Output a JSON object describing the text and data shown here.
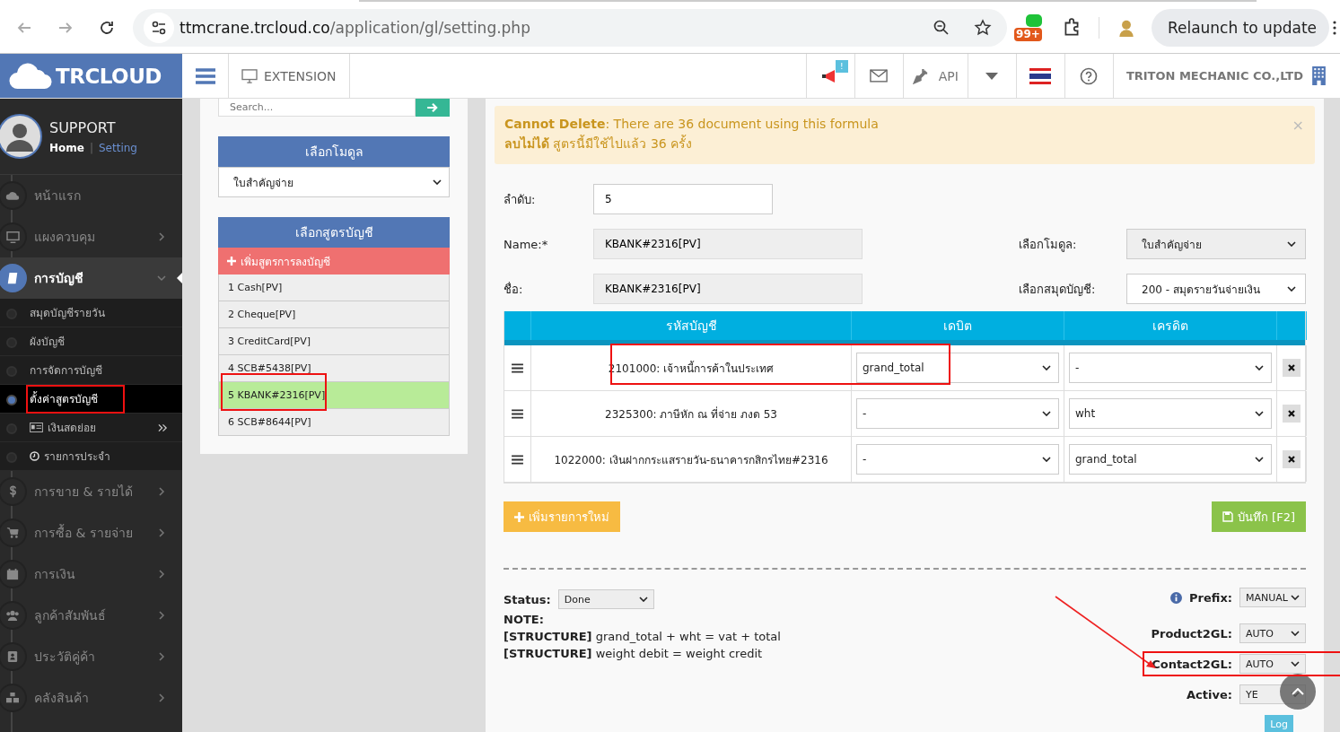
{
  "browser": {
    "url_host": "ttmcrane.trcloud.co",
    "url_path": "/application/gl/setting.php",
    "badge": "99+",
    "relaunch": "Relaunch to update"
  },
  "header": {
    "logo": "TRCLOUD",
    "extension": "EXTENSION",
    "notify_badge": "!",
    "api": "API",
    "company": "TRITON MECHANIC CO.,LTD"
  },
  "sidebar": {
    "user": "SUPPORT",
    "home": "Home",
    "separator": "|",
    "setting": "Setting",
    "items": [
      {
        "label": "หน้าแรก",
        "selected": false,
        "expanded": false
      },
      {
        "label": "แผงควบคุม",
        "selected": false,
        "expanded": false
      },
      {
        "label": "การบัญชี",
        "selected": true,
        "expanded": true,
        "children": [
          {
            "label": "สมุดบัญชีรายวัน",
            "selected": false,
            "annotated": false
          },
          {
            "label": "ผังบัญชี",
            "selected": false,
            "annotated": false
          },
          {
            "label": "การจัดการบัญชี",
            "selected": false,
            "annotated": false
          },
          {
            "label": "ตั้งค่าสูตรบัญชี",
            "selected": true,
            "annotated": true
          },
          {
            "label": "เงินสดย่อย",
            "selected": false,
            "annotated": false
          },
          {
            "label": "รายการประจำ",
            "selected": false,
            "annotated": false
          }
        ]
      },
      {
        "label": "การขาย & รายได้",
        "selected": false,
        "expanded": false
      },
      {
        "label": "การซื้อ & รายจ่าย",
        "selected": false,
        "expanded": false
      },
      {
        "label": "การเงิน",
        "selected": false,
        "expanded": false
      },
      {
        "label": "ลูกค้าสัมพันธ์",
        "selected": false,
        "expanded": false
      },
      {
        "label": "ประวัติคู่ค้า",
        "selected": false,
        "expanded": false
      },
      {
        "label": "คลังสินค้า",
        "selected": false,
        "expanded": false
      }
    ]
  },
  "panel": {
    "search_placeholder": "Search...",
    "module_title": "เลือกโมดูล",
    "module_value": "ใบสำคัญจ่าย",
    "formula_title": "เลือกสูตรบัญชี",
    "add_label": "เพิ่มสูตรการลงบัญชี",
    "formulas": [
      {
        "label": "1 Cash[PV]",
        "selected": false,
        "annotated": false
      },
      {
        "label": "2 Cheque[PV]",
        "selected": false,
        "annotated": false
      },
      {
        "label": "3 CreditCard[PV]",
        "selected": false,
        "annotated": false
      },
      {
        "label": "4 SCB#5438[PV]",
        "selected": false,
        "annotated": false
      },
      {
        "label": "5 KBANK#2316[PV]",
        "selected": true,
        "annotated": true
      },
      {
        "label": "6 SCB#8644[PV]",
        "selected": false,
        "annotated": false
      }
    ]
  },
  "alert": {
    "lines": [
      "**Cannot Delete**: There are 36 document using this formula",
      "**ลบไม่ได้** สูตรนี้มีใช้ไปแล้ว 36 ครั้ง"
    ],
    "close": "×"
  },
  "form": {
    "order": {
      "label": "ลำดับ:",
      "value": "5"
    },
    "name": {
      "label": "Name:*",
      "value": "KBANK#2316[PV]"
    },
    "thai_name": {
      "label": "ชื่อ:",
      "value": "KBANK#2316[PV]"
    },
    "module": {
      "label": "เลือกโมดูล:",
      "value": "ใบสำคัญจ่าย"
    },
    "journal": {
      "label": "เลือกสมุดบัญชี:",
      "value": "200 - สมุดรายวันจ่ายเงิน"
    }
  },
  "table": {
    "columns": [
      "รหัสบัญชี",
      "เดบิต",
      "เครดิต"
    ],
    "rows": [
      {
        "account": "2101000: เจ้าหนี้การค้าในประเทศ",
        "debit": "grand_total",
        "credit": "-",
        "annotated": true
      },
      {
        "account": "2325300: ภาษีหัก ณ ที่จ่าย ภงด 53",
        "debit": "-",
        "credit": "wht",
        "annotated": false
      },
      {
        "account": "1022000: เงินฝากกระแสรายวัน-ธนาคารกสิกรไทย#2316",
        "debit": "-",
        "credit": "grand_total",
        "annotated": false
      }
    ]
  },
  "buttons": {
    "add": "เพิ่มรายการใหม่",
    "save": "บันทึก [F2]"
  },
  "footer": {
    "status": {
      "label": "Status:",
      "value": "Done"
    },
    "note_label": "NOTE:",
    "notes": [
      "**[STRUCTURE]** grand_total + wht = vat + total",
      "**[STRUCTURE]** weight debit = weight credit"
    ],
    "settings": [
      {
        "label": "Prefix:",
        "value": "MANUAL",
        "annotated": false
      },
      {
        "label": "Product2GL:",
        "value": "AUTO",
        "annotated": false
      },
      {
        "label": "Contact2GL:",
        "value": "AUTO",
        "annotated": true
      },
      {
        "label": "Active:",
        "value": "YE",
        "annotated": false
      }
    ],
    "log": "Log"
  }
}
